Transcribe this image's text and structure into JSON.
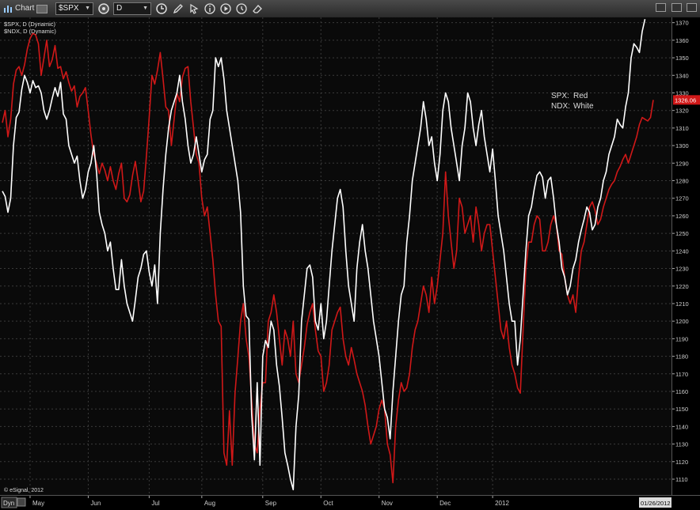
{
  "toolbar": {
    "title": "Chart",
    "symbol": "$SPX",
    "interval": "D"
  },
  "studies": [
    "$SPX, D (Dynamic)",
    "$NDX, D (Dynamic)"
  ],
  "legend": [
    {
      "key": "SPX:",
      "value": "Red"
    },
    {
      "key": "NDX:",
      "value": "White"
    }
  ],
  "copyright": "© eSignal, 2012",
  "footer": {
    "mode": "Dyn",
    "date_box": "01/26/2012"
  },
  "colors": {
    "spx": "#d01818",
    "ndx": "#ffffff",
    "background": "#0a0a0a",
    "grid": "#3a3a3a"
  },
  "chart_data": {
    "type": "line",
    "ylim": [
      1101,
      1373
    ],
    "yticks": [
      1110,
      1120,
      1130,
      1140,
      1150,
      1160,
      1170,
      1180,
      1190,
      1200,
      1210,
      1220,
      1230,
      1240,
      1250,
      1260,
      1270,
      1280,
      1290,
      1300,
      1310,
      1320,
      1330,
      1340,
      1350,
      1360,
      1370
    ],
    "x_month_labels": [
      {
        "label": "May",
        "index": 10
      },
      {
        "label": "Jun",
        "index": 31
      },
      {
        "label": "Jul",
        "index": 53
      },
      {
        "label": "Aug",
        "index": 72
      },
      {
        "label": "Sep",
        "index": 94
      },
      {
        "label": "Oct",
        "index": 115
      },
      {
        "label": "Nov",
        "index": 136
      },
      {
        "label": "Dec",
        "index": 157
      },
      {
        "label": "2012",
        "index": 177
      }
    ],
    "last_value_label": "1326.06",
    "series": [
      {
        "name": "SPX",
        "color": "#d01818",
        "values": [
          1313,
          1320,
          1305,
          1315,
          1335,
          1343,
          1345,
          1340,
          1346,
          1355,
          1361,
          1364,
          1363,
          1358,
          1340,
          1350,
          1360,
          1345,
          1349,
          1357,
          1344,
          1345,
          1338,
          1342,
          1336,
          1331,
          1334,
          1322,
          1328,
          1330,
          1333,
          1320,
          1306,
          1295,
          1290,
          1284,
          1290,
          1286,
          1280,
          1288,
          1280,
          1275,
          1284,
          1290,
          1270,
          1268,
          1272,
          1283,
          1291,
          1280,
          1268,
          1274,
          1294,
          1316,
          1340,
          1335,
          1343,
          1353,
          1338,
          1322,
          1320,
          1300,
          1315,
          1330,
          1325,
          1339,
          1344,
          1345,
          1325,
          1310,
          1295,
          1290,
          1270,
          1260,
          1265,
          1250,
          1235,
          1215,
          1200,
          1197,
          1125,
          1118,
          1149,
          1118,
          1159,
          1179,
          1200,
          1210,
          1190,
          1180,
          1155,
          1130,
          1125,
          1150,
          1165,
          1165,
          1200,
          1205,
          1215,
          1205,
          1190,
          1175,
          1195,
          1190,
          1180,
          1200,
          1170,
          1165,
          1175,
          1185,
          1198,
          1205,
          1210,
          1195,
          1183,
          1180,
          1160,
          1165,
          1175,
          1195,
          1200,
          1205,
          1208,
          1190,
          1180,
          1175,
          1185,
          1178,
          1170,
          1165,
          1160,
          1152,
          1140,
          1130,
          1135,
          1140,
          1150,
          1155,
          1150,
          1130,
          1124,
          1108,
          1140,
          1155,
          1165,
          1160,
          1162,
          1170,
          1185,
          1195,
          1200,
          1210,
          1220,
          1215,
          1205,
          1225,
          1210,
          1220,
          1235,
          1250,
          1285,
          1260,
          1245,
          1230,
          1240,
          1270,
          1265,
          1250,
          1255,
          1260,
          1245,
          1265,
          1255,
          1240,
          1250,
          1255,
          1255,
          1240,
          1225,
          1210,
          1195,
          1190,
          1200,
          1185,
          1175,
          1170,
          1162,
          1159,
          1195,
          1230,
          1245,
          1245,
          1255,
          1260,
          1258,
          1240,
          1240,
          1245,
          1255,
          1260,
          1255,
          1240,
          1238,
          1225,
          1215,
          1210,
          1215,
          1205,
          1225,
          1240,
          1245,
          1255,
          1265,
          1268,
          1263,
          1255,
          1258,
          1265,
          1270,
          1275,
          1278,
          1280,
          1285,
          1288,
          1292,
          1295,
          1290,
          1295,
          1300,
          1305,
          1312,
          1316,
          1315,
          1314,
          1316,
          1326
        ]
      },
      {
        "name": "NDX",
        "color": "#ffffff",
        "values": [
          1274,
          1271,
          1262,
          1270,
          1300,
          1316,
          1319,
          1332,
          1340,
          1336,
          1330,
          1337,
          1333,
          1334,
          1330,
          1320,
          1315,
          1320,
          1327,
          1333,
          1328,
          1336,
          1318,
          1315,
          1300,
          1295,
          1290,
          1294,
          1280,
          1270,
          1275,
          1285,
          1290,
          1300,
          1285,
          1262,
          1255,
          1250,
          1240,
          1245,
          1230,
          1218,
          1218,
          1235,
          1220,
          1210,
          1205,
          1200,
          1212,
          1225,
          1230,
          1238,
          1240,
          1228,
          1220,
          1232,
          1210,
          1250,
          1275,
          1295,
          1310,
          1320,
          1325,
          1330,
          1340,
          1325,
          1315,
          1300,
          1290,
          1295,
          1305,
          1295,
          1285,
          1292,
          1295,
          1315,
          1320,
          1350,
          1345,
          1350,
          1338,
          1320,
          1310,
          1300,
          1290,
          1280,
          1262,
          1220,
          1203,
          1201,
          1147,
          1121,
          1165,
          1118,
          1180,
          1189,
          1185,
          1200,
          1195,
          1175,
          1163,
          1145,
          1125,
          1118,
          1110,
          1104,
          1140,
          1158,
          1200,
          1215,
          1230,
          1232,
          1225,
          1200,
          1195,
          1210,
          1190,
          1200,
          1220,
          1240,
          1255,
          1270,
          1275,
          1265,
          1240,
          1220,
          1210,
          1200,
          1230,
          1245,
          1255,
          1240,
          1230,
          1215,
          1200,
          1190,
          1180,
          1165,
          1150,
          1145,
          1133,
          1160,
          1180,
          1200,
          1215,
          1220,
          1245,
          1260,
          1280,
          1290,
          1300,
          1310,
          1325,
          1315,
          1300,
          1305,
          1290,
          1280,
          1295,
          1320,
          1330,
          1325,
          1310,
          1300,
          1290,
          1280,
          1300,
          1310,
          1330,
          1325,
          1310,
          1300,
          1312,
          1320,
          1305,
          1295,
          1285,
          1298,
          1280,
          1260,
          1250,
          1240,
          1225,
          1210,
          1200,
          1200,
          1175,
          1190,
          1215,
          1240,
          1260,
          1265,
          1275,
          1283,
          1285,
          1282,
          1270,
          1280,
          1282,
          1270,
          1255,
          1245,
          1230,
          1225,
          1215,
          1220,
          1230,
          1235,
          1245,
          1252,
          1258,
          1265,
          1262,
          1252,
          1255,
          1265,
          1270,
          1280,
          1285,
          1295,
          1300,
          1305,
          1315,
          1312,
          1310,
          1322,
          1330,
          1350,
          1358,
          1356,
          1353,
          1365,
          1372
        ]
      }
    ]
  }
}
